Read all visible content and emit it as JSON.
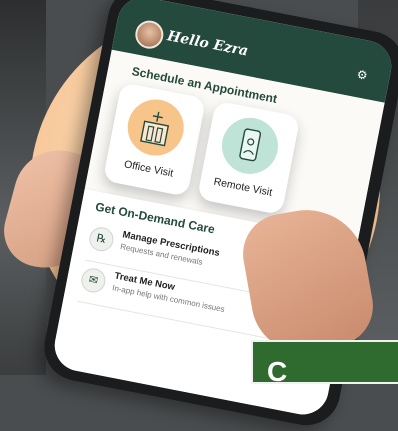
{
  "header": {
    "greeting": "Hello Ezra"
  },
  "schedule": {
    "title": "Schedule an Appointment",
    "cards": [
      {
        "label": "Office Visit",
        "icon": "office-building-icon",
        "color": "#f7c48a"
      },
      {
        "label": "Remote Visit",
        "icon": "smartphone-icon",
        "color": "#bfe3d6"
      }
    ]
  },
  "ondemand": {
    "title": "Get On-Demand Care",
    "items": [
      {
        "title": "Manage Prescriptions",
        "subtitle": "Requests and renewals",
        "icon": "prescription-icon"
      },
      {
        "title": "Treat Me Now",
        "subtitle": "In-app help with common issues",
        "icon": "chat-icon"
      }
    ]
  },
  "banner": {
    "text": "C"
  },
  "colors": {
    "brand": "#234a3d",
    "peach": "#f7c89a",
    "banner": "#2f6b2e"
  }
}
